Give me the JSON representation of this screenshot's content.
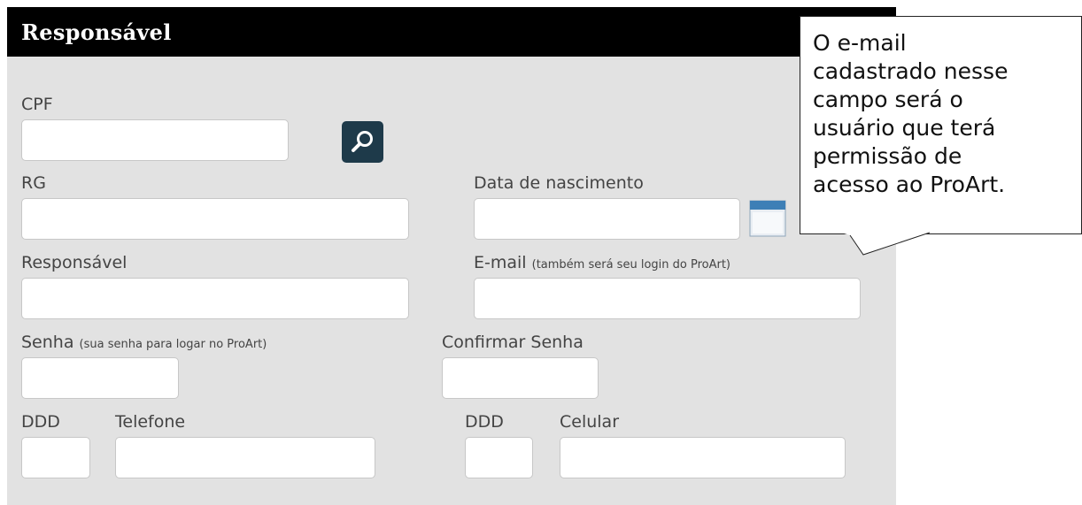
{
  "panel": {
    "title": "Responsável"
  },
  "form": {
    "cpf_label": "CPF",
    "cpf_value": "",
    "rg_label": "RG",
    "rg_value": "",
    "birth_label": "Data de nascimento",
    "birth_value": "",
    "responsavel_label": "Responsável",
    "responsavel_value": "",
    "email_label": "E-mail",
    "email_hint": "(também será seu login do ProArt)",
    "email_value": "",
    "password_label": "Senha",
    "password_hint": "(sua senha para logar no ProArt)",
    "password_value": "",
    "confirm_password_label": "Confirmar Senha",
    "confirm_password_value": "",
    "ddd_phone_label": "DDD",
    "ddd_phone_value": "",
    "phone_label": "Telefone",
    "phone_value": "",
    "ddd_mobile_label": "DDD",
    "ddd_mobile_value": "",
    "mobile_label": "Celular",
    "mobile_value": ""
  },
  "callout": {
    "text": "O e-mail\ncadastrado nesse\ncampo será o\nusuário que terá\npermissão de\nacesso ao ProArt."
  },
  "icons": {
    "search": "magnifier-icon",
    "calendar": "calendar-icon"
  },
  "colors": {
    "header_bg": "#000000",
    "panel_bg": "#e2e2e2",
    "search_button_bg": "#1e3a4a",
    "label_text": "#444444"
  }
}
